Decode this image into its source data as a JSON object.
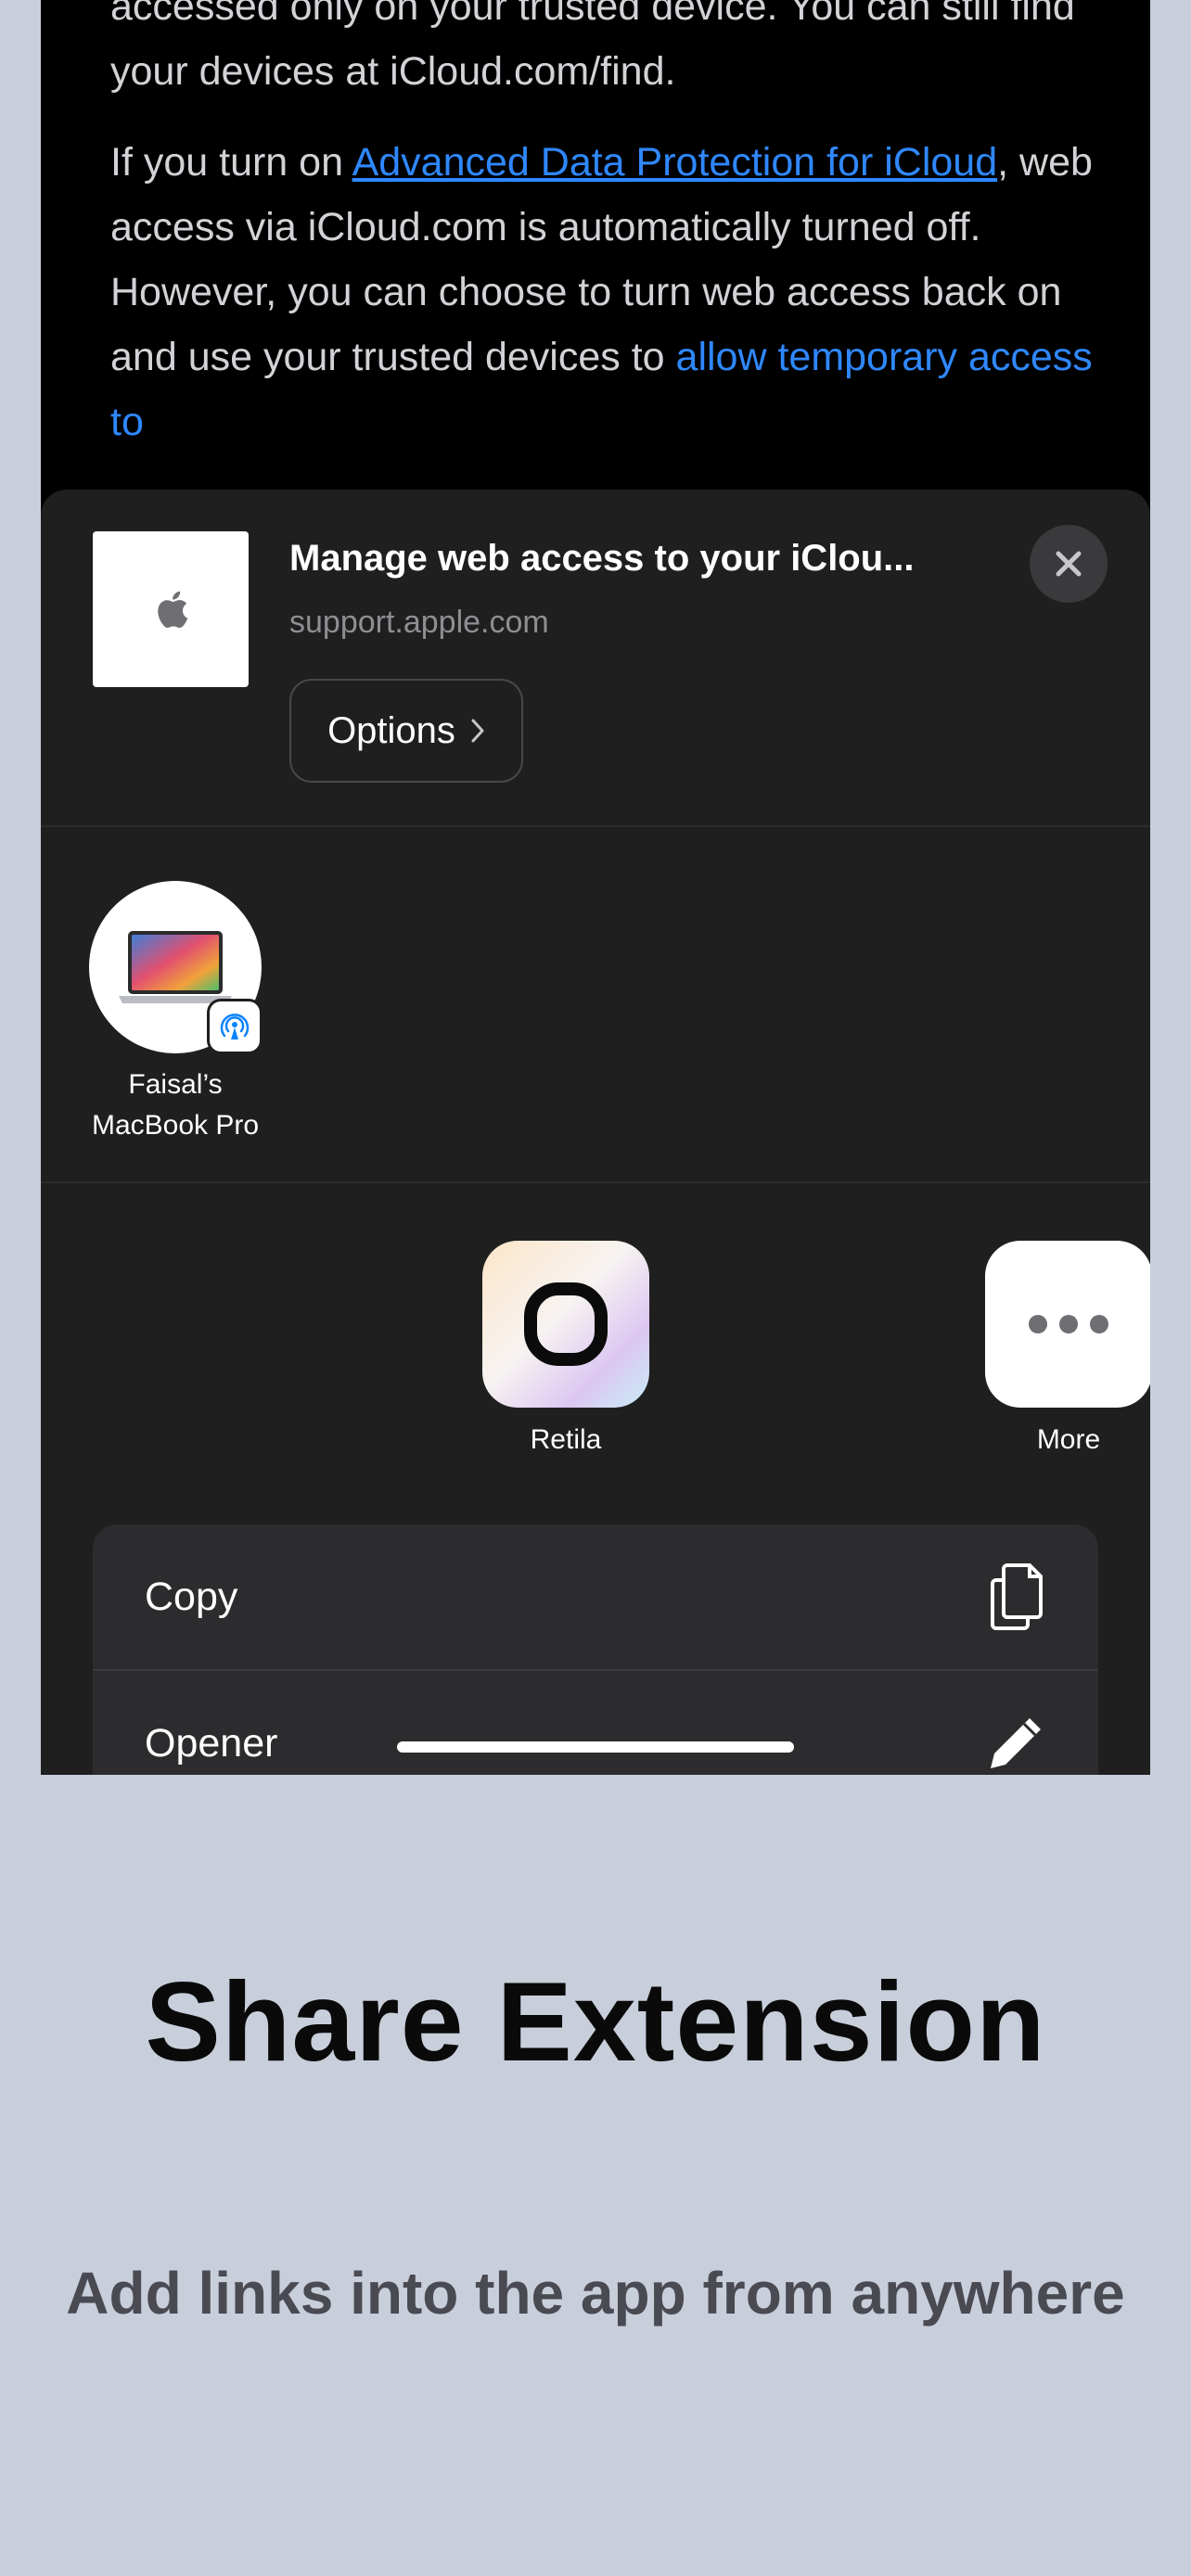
{
  "article": {
    "p1_text": "accessed only on your trusted device. You can still find your devices at iCloud.com/find.",
    "p2_link1": "Advanced Data Protection for iCloud",
    "p2_pre": "If you turn on ",
    "p2_mid": ", web access via iCloud.com is automatically turned off. However, you can choose to turn web access back on and use your trusted devices to ",
    "p2_link2": "allow temporary access to"
  },
  "share_sheet": {
    "title": "Manage web access to your iClou...",
    "url": "support.apple.com",
    "options_label": "Options",
    "close_icon": "close-icon",
    "airdrop_device": {
      "name": "Faisal's MacBook Pro",
      "name_line1": "Faisal’s",
      "name_line2": "MacBook Pro",
      "badge_icon": "airdrop-icon"
    },
    "apps": [
      {
        "label": "Retila",
        "icon": "retila-app-icon"
      },
      {
        "label": "More",
        "icon": "more-icon"
      }
    ],
    "actions": [
      {
        "label": "Copy",
        "icon": "copy-icon"
      },
      {
        "label": "Opener",
        "icon": "pencil-icon"
      }
    ]
  },
  "promo": {
    "title": "Share Extension",
    "subtitle": "Add links into the app from anywhere"
  },
  "colors": {
    "link": "#2f88ff",
    "background": "#c8cfdb",
    "sheet": "#1f1f1f"
  }
}
